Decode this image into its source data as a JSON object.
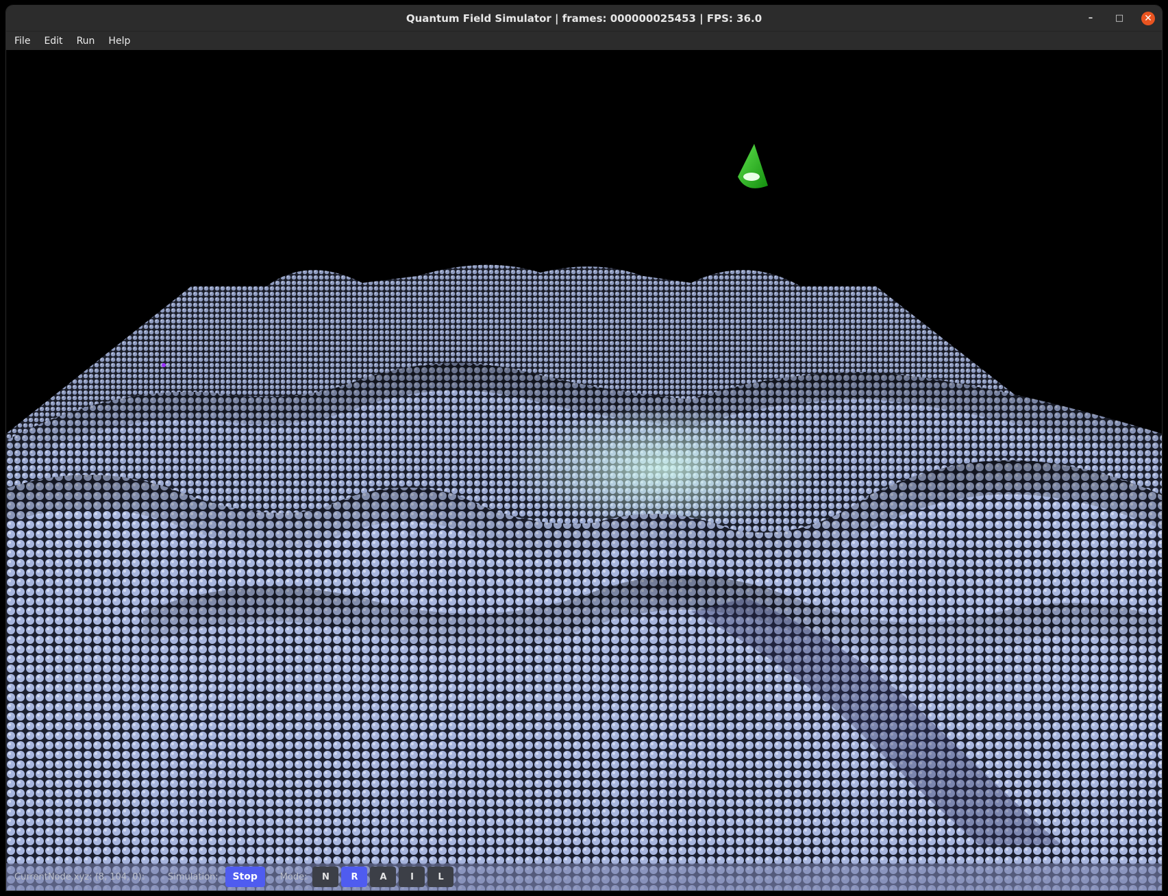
{
  "window": {
    "title": "Quantum Field Simulator  | frames: 000000025453 | FPS: 36.0",
    "controls": [
      "–",
      "□",
      "✕"
    ]
  },
  "menu": {
    "items": [
      "File",
      "Edit",
      "Run",
      "Help"
    ]
  },
  "status": {
    "current_node": "CurrentNode.xyz: (8, 104, 0):",
    "simulation_label": "Simulation:",
    "simulation_button": "Stop",
    "mode_label": "Mode:",
    "modes": [
      "N",
      "R",
      "A",
      "I",
      "L"
    ],
    "active_mode": "R"
  },
  "colors": {
    "sphere": "#9fb0dc",
    "sphere_highlight": "#c9ffe8",
    "marker": "#22b51c",
    "button_active": "#4f5cf0"
  },
  "icons": {
    "light_marker": "green-cone-icon"
  }
}
